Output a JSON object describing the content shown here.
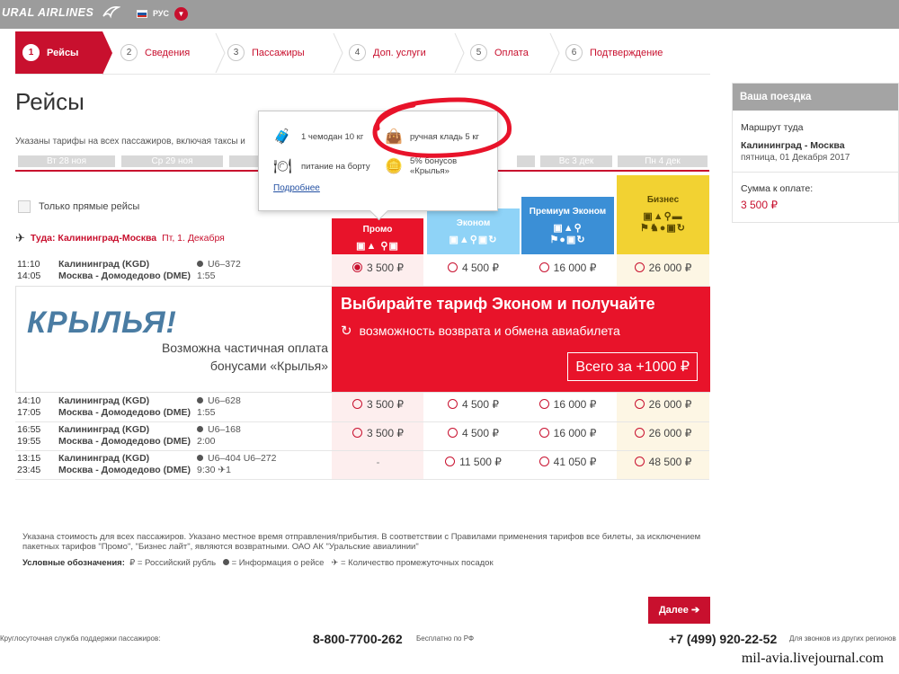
{
  "header": {
    "logo": "URAL AIRLINES",
    "language": "РУС"
  },
  "steps": [
    {
      "num": "1",
      "label": "Рейсы"
    },
    {
      "num": "2",
      "label": "Сведения"
    },
    {
      "num": "3",
      "label": "Пассажиры"
    },
    {
      "num": "4",
      "label": "Доп. услуги"
    },
    {
      "num": "5",
      "label": "Оплата"
    },
    {
      "num": "6",
      "label": "Подтверждение"
    }
  ],
  "page": {
    "title": "Рейсы",
    "fare_note": "Указаны тарифы на всех пассажиров, включая таксы и"
  },
  "dates": [
    "Вт 28 ноя",
    "Ср 29 ноя",
    "",
    "",
    "",
    "Вс 3 дек",
    "Пн 4 дек"
  ],
  "filter": {
    "direct_only": "Только прямые рейсы"
  },
  "route": {
    "label": "Туда: Калининград-Москва",
    "date": "Пт, 1. Декабря"
  },
  "fares": [
    {
      "name": "Промо",
      "icons": "🧳👜 🍽🪙",
      "color": "#e8132a",
      "text": "#ffffff"
    },
    {
      "name": "Эконом",
      "icons": "🧳👜🍽🪙↻",
      "color": "#8fd3f7",
      "text": "#ffffff"
    },
    {
      "name": "Премиум Эконом",
      "icons": "🧳👜🍽 ✈🪙↻",
      "color": "#3b8fd6",
      "text": "#ffffff"
    },
    {
      "name": "Бизнес",
      "icons": "🧳👜🍽🛋 ✈🪙↻",
      "color": "#f2d232",
      "text": "#5a4a00"
    }
  ],
  "flights": [
    {
      "dep": "11:10",
      "arr": "14:05",
      "from": "Калининград (KGD)",
      "to": "Москва - Домодедово (DME)",
      "number": "U6–372",
      "duration": "1:55",
      "prices": [
        "3 500 ₽",
        "4 500 ₽",
        "16 000 ₽",
        "26 000 ₽"
      ],
      "selected": 0
    },
    {
      "dep": "14:10",
      "arr": "17:05",
      "from": "Калининград (KGD)",
      "to": "Москва - Домодедово (DME)",
      "number": "U6–628",
      "duration": "1:55",
      "prices": [
        "3 500 ₽",
        "4 500 ₽",
        "16 000 ₽",
        "26 000 ₽"
      ],
      "selected": -1
    },
    {
      "dep": "16:55",
      "arr": "19:55",
      "from": "Калининград (KGD)",
      "to": "Москва - Домодедово (DME)",
      "number": "U6–168",
      "duration": "2:00",
      "prices": [
        "3 500 ₽",
        "4 500 ₽",
        "16 000 ₽",
        "26 000 ₽"
      ],
      "selected": -1
    },
    {
      "dep": "13:15",
      "arr": "23:45",
      "from": "Калининград (KGD)",
      "to": "Москва - Домодедово (DME)",
      "number": "U6–404  U6–272",
      "duration": "9:30 ✈1",
      "prices": [
        "-",
        "11 500 ₽",
        "41 050 ₽",
        "48 500 ₽"
      ],
      "selected": -1
    }
  ],
  "banner": {
    "brand": "КРЫЛЬЯ!",
    "partial_line1": "Возможна частичная оплата",
    "partial_line2": "бонусами «Крылья»",
    "headline": "Выбирайте тариф Эконом и получайте",
    "sub": "возможность возврата и обмена авиабилета",
    "cta": "Всего за +1000 ₽"
  },
  "tooltip": {
    "item1": "1 чемодан 10 кг",
    "item2": "ручная кладь 5 кг",
    "item3": "питание на борту",
    "item4_line1": "5% бонусов",
    "item4_line2": "«Крылья»",
    "more": "Подробнее"
  },
  "sidebar": {
    "title": "Ваша поездка",
    "route_label": "Маршрут туда",
    "route": "Калининград - Москва",
    "date": "пятница, 01 Декабря 2017",
    "sum_label": "Сумма к оплате:",
    "sum": "3 500 ₽"
  },
  "footer": {
    "legal": "Указана стоимость для всех пассажиров. Указано местное время отправления/прибытия. В соответствии с Правилами применения тарифов все билеты, за исключением пакетных тарифов \"Промо\", \"Бизнес лайт\", являются возвратными. ОАО АК \"Уральские авиалинии\"",
    "legend_title": "Условные обозначения:",
    "legend_1": "₽ = Российский рубль",
    "legend_2": "= Информация о рейсе",
    "legend_3": "= Количество промежуточных посадок",
    "next": "Далее",
    "support": "Круглосуточная служба поддержки пассажиров:",
    "phone1": "8-800-7700-262",
    "free": "Бесплатно по РФ",
    "phone2": "+7 (499) 920-22-52",
    "abroad": "Для звонков из других регионов"
  },
  "watermark": "mil-avia.livejournal.com"
}
